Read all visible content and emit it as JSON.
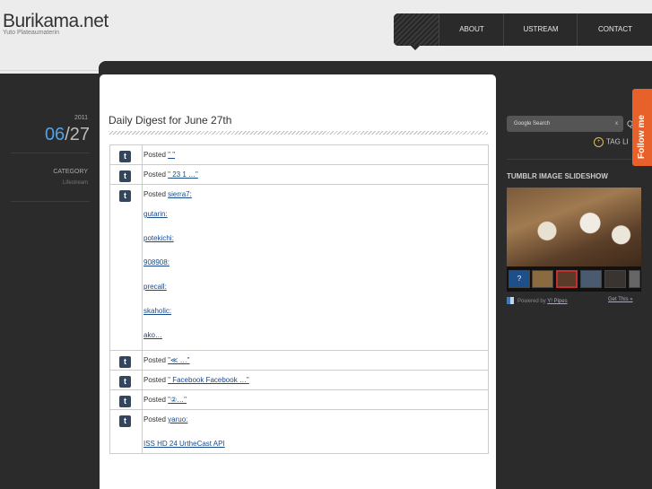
{
  "site": {
    "title": "Burikama.net",
    "tagline": "Yuto Plateaumaterin"
  },
  "nav": {
    "items": [
      "ABOUT",
      "USTREAM",
      "CONTACT"
    ]
  },
  "post": {
    "year": "2011",
    "month": "06",
    "day": "27",
    "category_label": "CATEGORY",
    "category_value": "Lifestream",
    "title": "Daily Digest for June 27th"
  },
  "entries": [
    {
      "prefix": "Posted ",
      "link": "\"                    \""
    },
    {
      "prefix": "Posted ",
      "link": "\"    23  1                                                           …\""
    },
    {
      "prefix": "Posted ",
      "link": "sierra7:",
      "extra": [
        "gutarin:",
        "potekichi:",
        "908908:",
        "precall:",
        "skaholic:",
        "ako…"
      ]
    },
    {
      "prefix": "Posted ",
      "link": "\"≪       …\""
    },
    {
      "prefix": "Posted ",
      "link": "\"                                        Facebook              Facebook                   …\""
    },
    {
      "prefix": "Posted ",
      "link": "\"②…\""
    },
    {
      "prefix": "Posted ",
      "link": "yaruo:",
      "extra": [
        "ISS  HD   24     UrtheCast    API"
      ]
    }
  ],
  "sidebar": {
    "search_placeholder": "Google Search",
    "search_clear": "x",
    "search_button": "Q",
    "tag_list": "TAG LI",
    "slideshow_title": "TUMBLR IMAGE SLIDESHOW",
    "powered_text": "Powered by",
    "powered_link": "Y! Pipes",
    "get_this": "Get This »"
  },
  "follow": {
    "label": "Follow me"
  },
  "colors": {
    "accent_blue": "#4fa3e8",
    "dark_bg": "#2b2b2b",
    "follow_orange": "#e8602a",
    "tumblr_blue": "#34465d"
  }
}
